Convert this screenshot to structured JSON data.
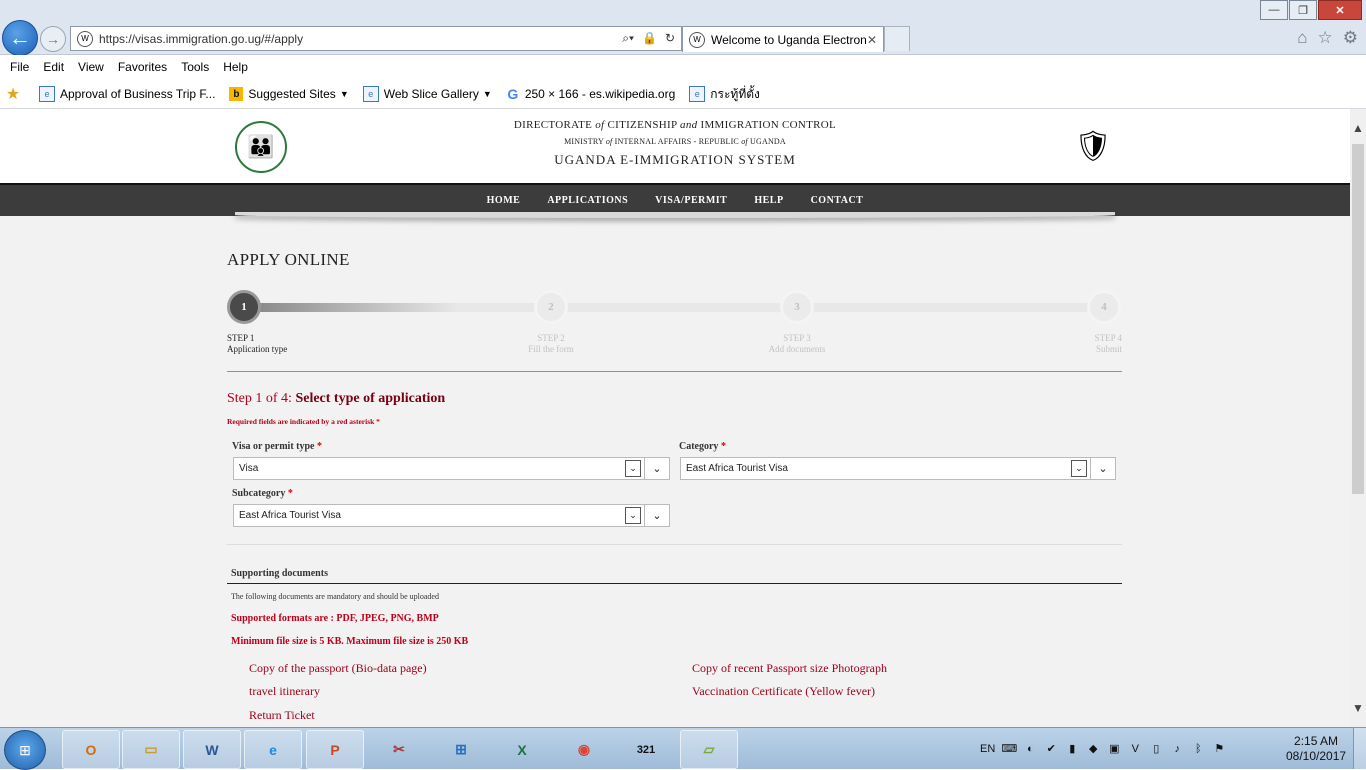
{
  "browser": {
    "url": "https://visas.immigration.go.ug/#/apply",
    "tab_title": "Welcome to Uganda Electroni...",
    "menu": [
      "File",
      "Edit",
      "View",
      "Favorites",
      "Tools",
      "Help"
    ],
    "favorites": [
      {
        "label": "Approval of Business Trip F...",
        "icon": "page-icon"
      },
      {
        "label": "Suggested Sites",
        "icon": "bing-icon",
        "dropdown": true
      },
      {
        "label": "Web Slice Gallery",
        "icon": "page-icon",
        "dropdown": true
      },
      {
        "label": "250 × 166 - es.wikipedia.org",
        "icon": "google-icon"
      },
      {
        "label": "กระทู้ที่ตั้ง",
        "icon": "page-icon"
      }
    ]
  },
  "site": {
    "header_line1_pre": "DIRECTORATE",
    "header_line1_em1": "of",
    "header_line1_mid": "CITIZENSHIP",
    "header_line1_em2": "and",
    "header_line1_post": "IMMIGRATION CONTROL",
    "header_line2_pre": "MINISTRY",
    "header_line2_em1": "of",
    "header_line2_mid": "INTERNAL AFFAIRS - REPUBLIC",
    "header_line2_em2": "of",
    "header_line2_post": "UGANDA",
    "header_line3": "UGANDA E-IMMIGRATION SYSTEM",
    "nav": [
      "HOME",
      "APPLICATIONS",
      "VISA/PERMIT",
      "HELP",
      "CONTACT"
    ]
  },
  "apply": {
    "title": "APPLY ONLINE",
    "steps": [
      {
        "num": "1",
        "title": "STEP 1",
        "desc": "Application type",
        "active": true
      },
      {
        "num": "2",
        "title": "STEP 2",
        "desc": "Fill the form",
        "active": false
      },
      {
        "num": "3",
        "title": "STEP 3",
        "desc": "Add documents",
        "active": false
      },
      {
        "num": "4",
        "title": "STEP 4",
        "desc": "Submit",
        "active": false
      }
    ],
    "step_heading_prefix": "Step 1 of 4: ",
    "step_heading_bold": "Select type of application",
    "required_note": "Required fields are indicated by a red asterisk",
    "asterisk": "*",
    "fields": {
      "visa_type": {
        "label": "Visa or permit type",
        "value": "Visa"
      },
      "category": {
        "label": "Category",
        "value": "East Africa Tourist Visa"
      },
      "subcategory": {
        "label": "Subcategory",
        "value": "East Africa Tourist Visa"
      }
    },
    "supporting": {
      "heading": "Supporting documents",
      "note": "The following documents are mandatory and should be uploaded",
      "formats": "Supported formats are : PDF, JPEG, PNG, BMP",
      "filesize": "Minimum file size is 5 KB. Maximum file size is 250 KB",
      "documents": [
        "Copy of the passport (Bio-data page)",
        "Copy of recent Passport size Photograph",
        "travel itinerary",
        "Vaccination Certificate (Yellow fever)",
        "Return Ticket"
      ]
    }
  },
  "taskbar": {
    "apps": [
      "outlook-icon",
      "explorer-icon",
      "word-icon",
      "ie-icon",
      "powerpoint-icon",
      "snipping-icon",
      "windows-icon",
      "excel-icon",
      "chrome-icon",
      "calendar-icon",
      "sticky-notes-icon"
    ],
    "lang": "EN",
    "calendar_day": "321",
    "time": "2:15 AM",
    "date": "08/10/2017"
  }
}
